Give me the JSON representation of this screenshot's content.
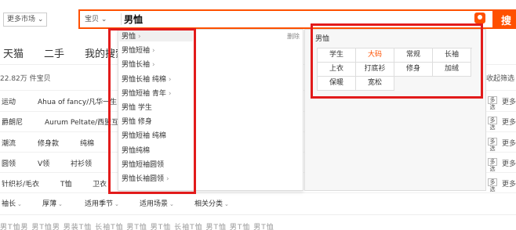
{
  "search": {
    "market_label": "更多市场",
    "category_label": "宝贝",
    "query": "男恤",
    "button_label": "搜"
  },
  "tabs": [
    "天猫",
    "二手",
    "我的搜索"
  ],
  "results": {
    "count": "22.82万 件宝贝",
    "collapse": "收起筛选"
  },
  "filters": {
    "row1": {
      "label": "运动",
      "items": [
        "Ahua of fancy/凡华一生"
      ]
    },
    "row2": {
      "label": "爵朗尼",
      "items": [
        "Aurum Peltate/西盟互盾"
      ]
    },
    "row3": {
      "label": "潮流",
      "items": [
        "修身款",
        "纯棉"
      ]
    },
    "row4": {
      "label": "圆领",
      "items": [
        "V领",
        "衬衫领"
      ]
    },
    "row5": {
      "label": "针织衫/毛衣",
      "items": [
        "T恤",
        "卫衣"
      ]
    },
    "more": "更多",
    "multi": "多选"
  },
  "attrs": [
    "袖长",
    "厚薄",
    "适用季节",
    "适用场景",
    "相关分类"
  ],
  "bottom_text": "男T恤男 男T恤男 男装T恤 长袖T恤 男T恤 男T恤 长袖T恤 男T恤 男T恤 男T恤",
  "dropdown": {
    "delete_label": "删除",
    "suggestions": [
      {
        "text": "男恤",
        "arrow": true
      },
      {
        "text": "男恤短袖",
        "arrow": true
      },
      {
        "text": "男恤长袖",
        "arrow": true
      },
      {
        "text": "男恤长袖 纯棉",
        "arrow": true
      },
      {
        "text": "男恤短袖 青年",
        "arrow": true
      },
      {
        "text": "男恤 学生",
        "arrow": false
      },
      {
        "text": "男恤 修身",
        "arrow": false
      },
      {
        "text": "男恤短袖 纯棉",
        "arrow": false
      },
      {
        "text": "男恤纯棉",
        "arrow": false
      },
      {
        "text": "男恤短袖圆领",
        "arrow": false
      },
      {
        "text": "男恤长袖圆领",
        "arrow": true
      }
    ],
    "right_title": "男恤",
    "tags": [
      "学生",
      "大码",
      "常规",
      "长袖",
      "上衣",
      "打底衫",
      "修身",
      "加绒",
      "保暖",
      "宽松"
    ],
    "hot_tag": "大码"
  },
  "colors": {
    "accent": "#ff5000",
    "highlight": "#e21b1b"
  }
}
